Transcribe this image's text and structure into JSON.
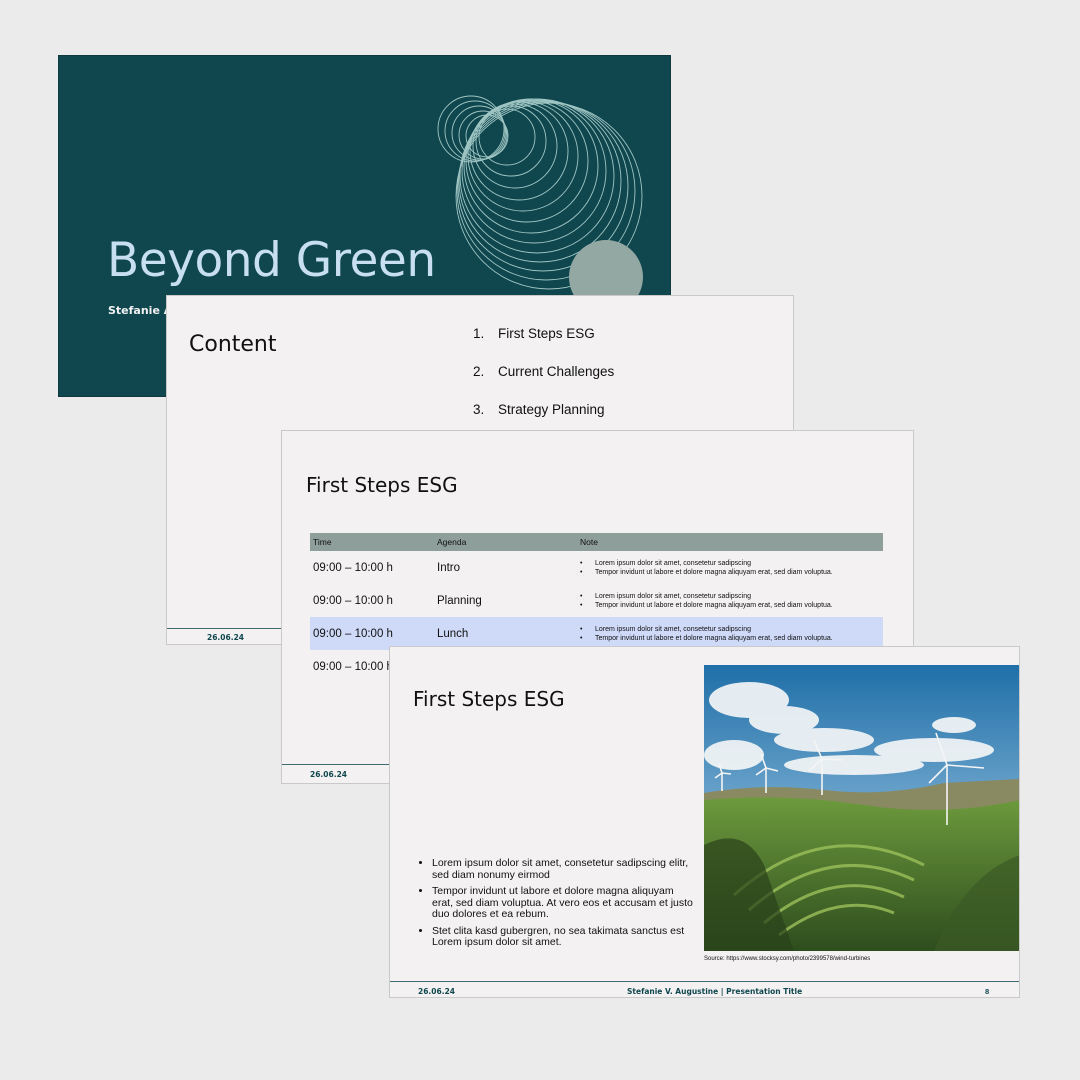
{
  "slides": {
    "title_slide": {
      "title": "Beyond Green",
      "author": "Stefanie Augustine"
    },
    "content_slide": {
      "heading": "Content",
      "items": [
        {
          "num": "1.",
          "label": "First Steps ESG"
        },
        {
          "num": "2.",
          "label": "Current Challenges"
        },
        {
          "num": "3.",
          "label": "Strategy Planning"
        }
      ],
      "date": "26.06.24"
    },
    "agenda_slide": {
      "heading": "First Steps ESG",
      "columns": [
        "Time",
        "Agenda",
        "Note"
      ],
      "rows": [
        {
          "time": "09:00 – 10:00 h",
          "agenda": "Intro",
          "notes": [
            "Lorem ipsum dolor sit amet, consetetur sadipscing",
            "Tempor invidunt ut labore et dolore magna aliquyam erat, sed diam voluptua."
          ]
        },
        {
          "time": "09:00 – 10:00 h",
          "agenda": "Planning",
          "notes": [
            "Lorem ipsum dolor sit amet, consetetur sadipscing",
            "Tempor invidunt ut labore et dolore magna aliquyam erat, sed diam voluptua."
          ]
        },
        {
          "time": "09:00 – 10:00 h",
          "agenda": "Lunch",
          "notes": [
            "Lorem ipsum dolor sit amet, consetetur sadipscing",
            "Tempor invidunt ut labore et dolore magna aliquyam erat, sed diam voluptua."
          ]
        },
        {
          "time": "09:00 – 10:00 h",
          "agenda": "",
          "notes": []
        }
      ],
      "date": "26.06.24"
    },
    "image_slide": {
      "heading": "First Steps ESG",
      "bullets": [
        "Lorem ipsum dolor sit amet, consetetur sadipscing elitr, sed diam nonumy eirmod",
        "Tempor invidunt ut labore et dolore magna aliquyam erat, sed diam voluptua. At vero eos et accusam et justo duo dolores et ea rebum.",
        "Stet clita kasd gubergren, no sea takimata sanctus est Lorem ipsum dolor sit amet."
      ],
      "image_source": "Source: https://www.stocksy.com/photo/2399578/wind-turbines",
      "date": "26.06.24",
      "presenter": "Stefanie V. Augustine | Presentation Title",
      "page_number": "8"
    }
  },
  "colors": {
    "background": "#ebebeb",
    "title_slide_bg": "#10474f",
    "title_text": "#c7dff0",
    "table_header": "#8e9e9a",
    "highlight_row": "#cfdaf9",
    "slide_bg": "#f3f1f1"
  }
}
